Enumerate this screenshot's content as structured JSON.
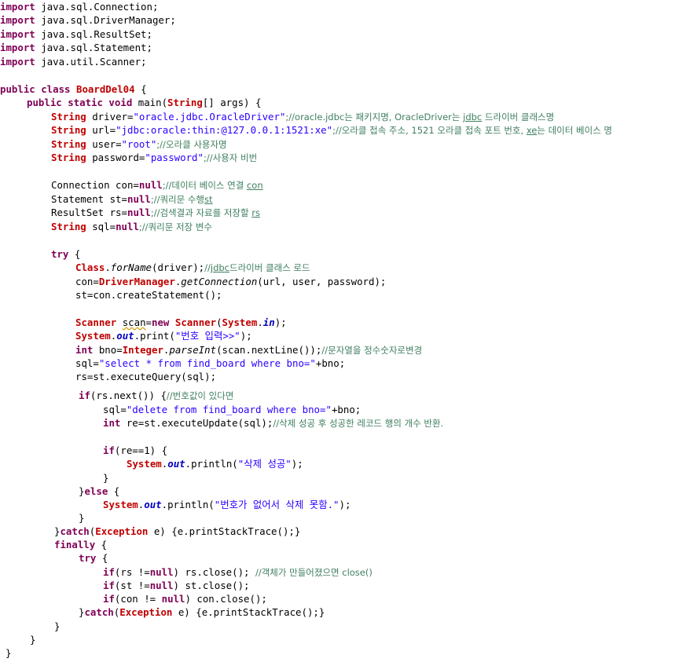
{
  "code": {
    "imports": [
      "java.sql.Connection;",
      "java.sql.DriverManager;",
      "java.sql.ResultSet;",
      "java.sql.Statement;",
      "java.util.Scanner;"
    ],
    "kw_import": "import",
    "class_decl": {
      "mods": "public class",
      "name": "BoardDel04",
      "rest": " {"
    },
    "main_decl": {
      "mods": "public static void",
      "rest1": " main(",
      "type": "String",
      "rest2": "[] args) {"
    },
    "driver": {
      "type": "String",
      "pre": " driver=",
      "str": "\"oracle.jdbc.OracleDriver\"",
      "mid": ";//oracle.jdbc는 패키지명, OracleDriver는 ",
      "ul": "jdbc",
      "cm": " 드라이버 클래스명"
    },
    "url": {
      "type": "String",
      "pre": " url=",
      "str": "\"jdbc:oracle:thin:@127.0.0.1:1521:xe\"",
      "mid": ";//오라클 접속 주소, 1521 오라클 접속 포트 번호, ",
      "ul": "xe",
      "cm": "는 데이터 베이스 명"
    },
    "user": {
      "type": "String",
      "pre": " user=",
      "str": "\"root\"",
      "cm": ";//오라클 사용자명"
    },
    "password": {
      "type": "String",
      "pre": " password=",
      "str": "\"password\"",
      "cm": ";//사용자 비번"
    },
    "con_decl": {
      "pre": "Connection con=",
      "kw": "null",
      "cm": ";//데이터 베이스 연결 ",
      "ul": "con"
    },
    "st_decl": {
      "pre": "Statement st=",
      "kw": "null",
      "cm": ";//쿼리문 수행",
      "ul": "st"
    },
    "rs_decl": {
      "pre": "ResultSet rs=",
      "kw": "null",
      "cm": ";//검색결과 자료를 저장할 ",
      "ul": "rs"
    },
    "sql_decl": {
      "type": "String",
      "pre": " sql=",
      "kw": "null",
      "cm": ";//쿼리문 저장 변수"
    },
    "try1": {
      "kw": "try",
      "rest": " {"
    },
    "forname": {
      "cls": "Class",
      "dot": ".",
      "method": "forName",
      "rest": "(driver);",
      "cm1": "//",
      "ul": "jdbc",
      "cm2": "드라이버 클래스 로드"
    },
    "getconn": {
      "pre": "con=",
      "cls": "DriverManager",
      "dot": ".",
      "method": "getConnection",
      "rest": "(url, user, password);"
    },
    "createst": {
      "text": "st=con.createStatement();"
    },
    "scanner": {
      "cls": "Scanner",
      "sp": " ",
      "var": "scan",
      "eq": "=",
      "kw": "new",
      "sp2": " ",
      "cls2": "Scanner",
      "p1": "(",
      "cls3": "System",
      "dot": ".",
      "fld": "in",
      "p2": ");"
    },
    "print1": {
      "cls": "System",
      "dot": ".",
      "fld": "out",
      "rest": ".print(",
      "str": "\"번호 입력>>\"",
      "end": ");"
    },
    "bno": {
      "kw": "int",
      "pre": " bno=",
      "cls": "Integer",
      "dot": ".",
      "method": "parseInt",
      "rest": "(scan.nextLine());",
      "cm": "//문자열을 정수숫자로변경"
    },
    "sql_select": {
      "pre": "sql=",
      "str": "\"select * from find_board where bno=\"",
      "rest": "+bno;"
    },
    "exec_query": {
      "text": "rs=st.executeQuery(sql);"
    },
    "if_next": {
      "kw": "if",
      "rest": "(rs.next()) {",
      "cm": "//번호값이 있다면"
    },
    "sql_delete": {
      "pre": "sql=",
      "str": "\"delete from find_board where bno=\"",
      "rest": "+bno;"
    },
    "exec_update": {
      "kw": "int",
      "rest": " re=st.executeUpdate(sql);",
      "cm": "//삭제 성공 후 성공한 레코드 행의 개수 반환."
    },
    "if_re": {
      "kw": "if",
      "rest": "(re==1) {"
    },
    "print_ok": {
      "cls": "System",
      "dot": ".",
      "fld": "out",
      "rest": ".println(",
      "str": "\"삭제 성공\"",
      "end": ");"
    },
    "close_brace": "}",
    "else_line": {
      "pre": "}",
      "kw": "else",
      "rest": " {"
    },
    "print_fail": {
      "cls": "System",
      "dot": ".",
      "fld": "out",
      "rest": ".println(",
      "str": "\"번호가 없어서 삭제 못함.\"",
      "end": ");"
    },
    "catch1": {
      "pre": "}",
      "kw": "catch",
      "p": "(",
      "cls": "Exception",
      "rest": " e) {e.printStackTrace();}"
    },
    "finally": {
      "kw": "finally",
      "rest": " {"
    },
    "try2": {
      "kw": "try",
      "rest": " {"
    },
    "close_rs": {
      "kw": "if",
      "p": "(rs !=",
      "kw2": "null",
      "rest": ") rs.close(); ",
      "cm": "//객체가 만들어졌으면 close()"
    },
    "close_st": {
      "kw": "if",
      "p": "(st !=",
      "kw2": "null",
      "rest": ") st.close();"
    },
    "close_con": {
      "kw": "if",
      "p": "(con != ",
      "kw2": "null",
      "rest": ") con.close();"
    },
    "catch2": {
      "pre": "}",
      "kw": "catch",
      "p": "(",
      "cls": "Exception",
      "rest": " e) {e.printStackTrace();}"
    }
  }
}
